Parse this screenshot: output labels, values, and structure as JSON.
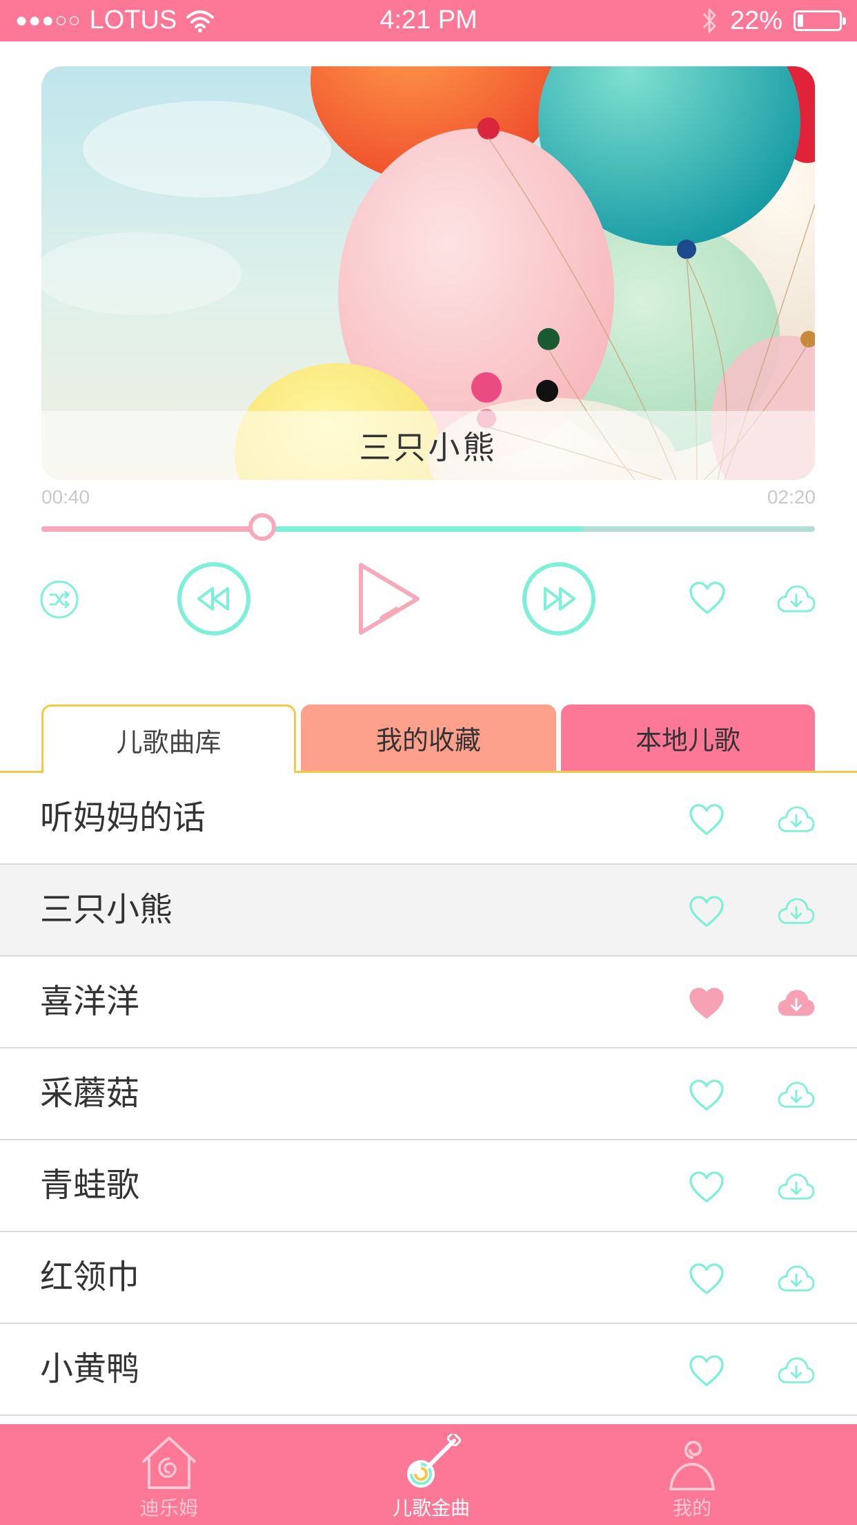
{
  "status_bar": {
    "signal_dots": "●●●○○",
    "carrier": "LOTUS",
    "time": "4:21 PM",
    "battery_text": "22%",
    "battery_level": 0.22
  },
  "player": {
    "current_song": "三只小熊",
    "current_time": "00:40",
    "total_time": "02:20",
    "progress": 0.2857,
    "buffered": 0.7,
    "cover_icon": "balloons-image"
  },
  "controls": {
    "shuffle_icon": "shuffle-icon",
    "prev_icon": "rewind-icon",
    "play_icon": "play-icon",
    "next_icon": "fast-forward-icon",
    "favorite_icon": "heart-icon",
    "download_icon": "cloud-download-icon"
  },
  "tabs": [
    {
      "label": "儿歌曲库",
      "active": true
    },
    {
      "label": "我的收藏",
      "active": false
    },
    {
      "label": "本地儿歌",
      "active": false
    }
  ],
  "songs": [
    {
      "title": "听妈妈的话",
      "favorited": false,
      "downloaded": false,
      "playing": false
    },
    {
      "title": "三只小熊",
      "favorited": false,
      "downloaded": false,
      "playing": true
    },
    {
      "title": "喜洋洋",
      "favorited": true,
      "downloaded": true,
      "playing": false
    },
    {
      "title": "采蘑菇",
      "favorited": false,
      "downloaded": false,
      "playing": false
    },
    {
      "title": "青蛙歌",
      "favorited": false,
      "downloaded": false,
      "playing": false
    },
    {
      "title": "红领巾",
      "favorited": false,
      "downloaded": false,
      "playing": false
    },
    {
      "title": "小黄鸭",
      "favorited": false,
      "downloaded": false,
      "playing": false
    }
  ],
  "bottom_nav": [
    {
      "label": "迪乐姆",
      "icon": "house-swirl-icon",
      "active": false
    },
    {
      "label": "儿歌金曲",
      "icon": "guitar-lollipop-icon",
      "active": true
    },
    {
      "label": "我的",
      "icon": "person-swirl-icon",
      "active": false
    }
  ],
  "colors": {
    "brand_pink": "#fd7796",
    "mint": "#7ff0d8",
    "salmon": "#fda18c",
    "tab_outline": "#f7c743",
    "favorited": "#f7a1b4"
  }
}
